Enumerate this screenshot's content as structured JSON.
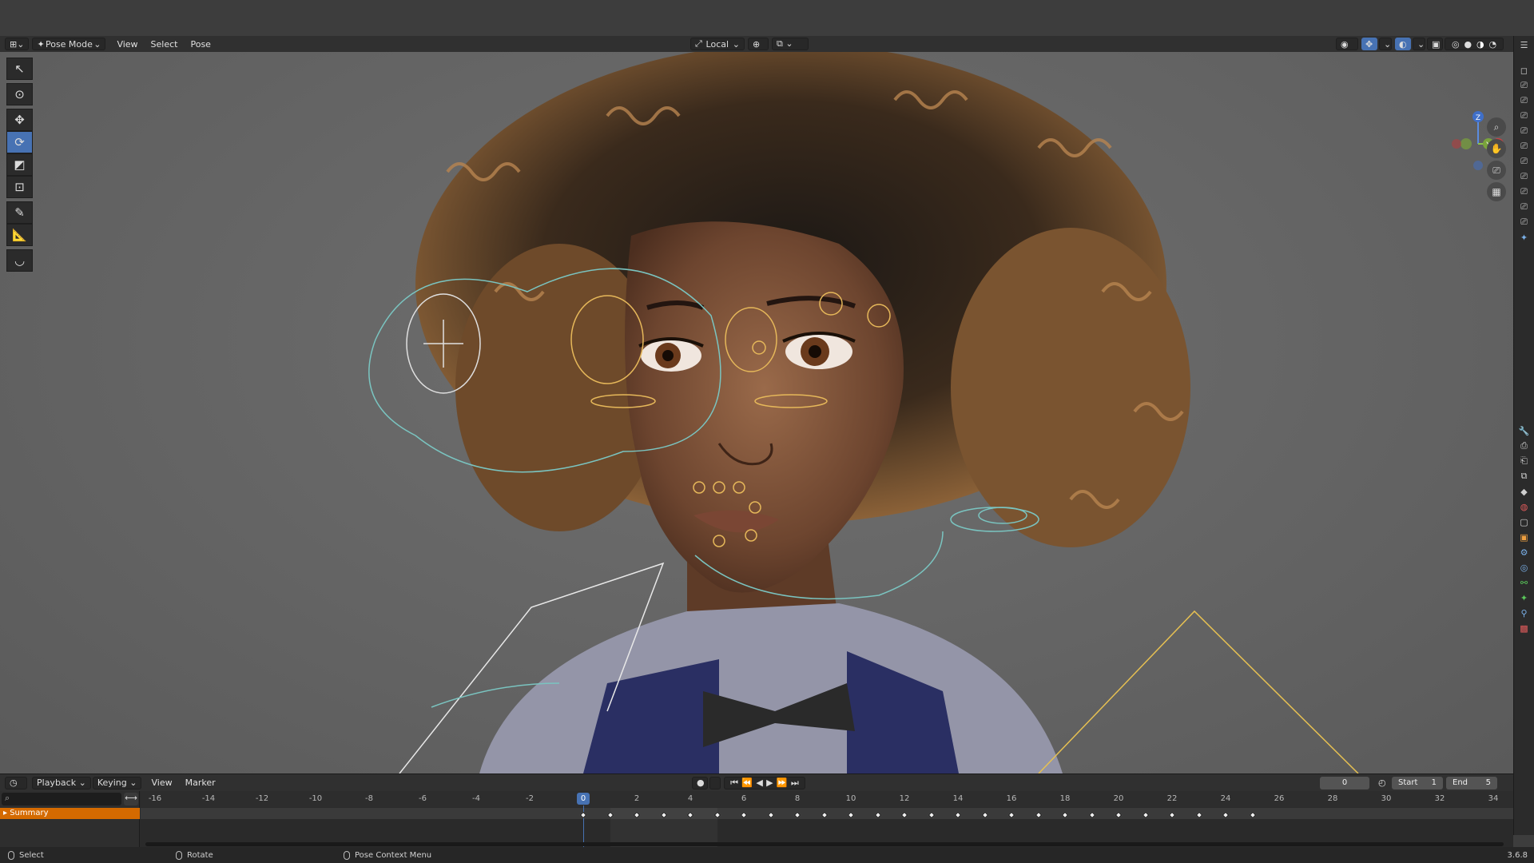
{
  "header": {
    "mode": "Pose Mode",
    "menus": [
      "View",
      "Select",
      "Pose"
    ],
    "orientation": "Local"
  },
  "tools": [
    "select-box",
    "cursor",
    "move",
    "rotate",
    "scale",
    "transform",
    "annotate",
    "measure",
    "relax-pose"
  ],
  "active_tool": "rotate",
  "gizmo": {
    "z": "Z",
    "y": "Y",
    "x": "X"
  },
  "timeline": {
    "menus": [
      "Playback",
      "Keying",
      "View",
      "Marker"
    ],
    "current_frame": "0",
    "start_label": "Start",
    "start_value": "1",
    "end_label": "End",
    "end_value": "5",
    "summary_label": "Summary",
    "ticks": [
      "-16",
      "-14",
      "-12",
      "-10",
      "-8",
      "-6",
      "-4",
      "-2",
      "0",
      "2",
      "4",
      "6",
      "8",
      "10",
      "12",
      "14",
      "16",
      "18",
      "20",
      "22",
      "24",
      "26",
      "28",
      "30",
      "32",
      "34"
    ],
    "keyframes": [
      0,
      1,
      2,
      3,
      4,
      5,
      6,
      7,
      8,
      9,
      10,
      11,
      12,
      13,
      14,
      15,
      16,
      17,
      18,
      19,
      20,
      21,
      22,
      23,
      24,
      25
    ]
  },
  "statusbar": {
    "select": "Select",
    "rotate": "Rotate",
    "context_menu": "Pose Context Menu",
    "version": "3.6.8"
  },
  "colors": {
    "accent": "#4772b3",
    "summary": "#d46a00"
  }
}
